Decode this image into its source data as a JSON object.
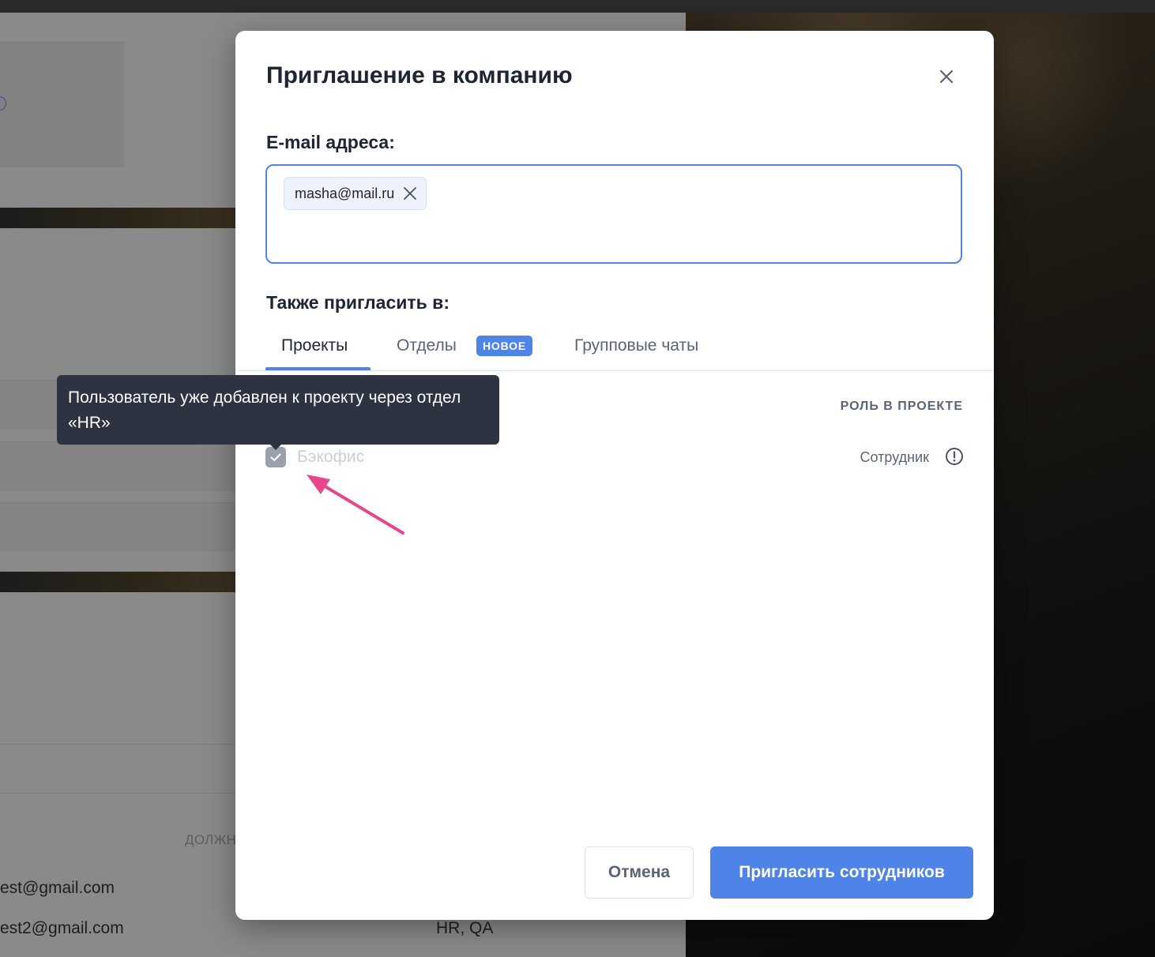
{
  "background": {
    "emails": [
      "est@gmail.com",
      "est2@gmail.com"
    ],
    "column_header": "ДОЛЖН",
    "departments": "HR, QA"
  },
  "modal": {
    "title": "Приглашение в компанию",
    "close_icon": "close-icon",
    "email_label": "E-mail адреса:",
    "email_chips": [
      {
        "value": "masha@mail.ru",
        "remove_icon": "close-icon"
      }
    ],
    "also_invite_label": "Также пригласить в:",
    "tabs": [
      {
        "label": "Проекты",
        "active": true
      },
      {
        "label": "Отделы",
        "active": false,
        "badge": "НОВОЕ"
      },
      {
        "label": "Групповые чаты",
        "active": false
      }
    ],
    "role_column_header": "РОЛЬ В ПРОЕКТЕ",
    "projects": [
      {
        "name": "Бэкофис",
        "checked": true,
        "disabled": true,
        "role": "Сотрудник",
        "role_icon": "info-icon"
      }
    ],
    "tooltip": "Пользователь уже добавлен к проекту через отдел «HR»",
    "buttons": {
      "cancel": "Отмена",
      "invite": "Пригласить сотрудников"
    }
  },
  "colors": {
    "accent": "#4e84e8",
    "title": "#1e2433",
    "muted": "#5b6375",
    "tooltip_bg": "#2d3340",
    "annotation_arrow": "#e8458b"
  }
}
